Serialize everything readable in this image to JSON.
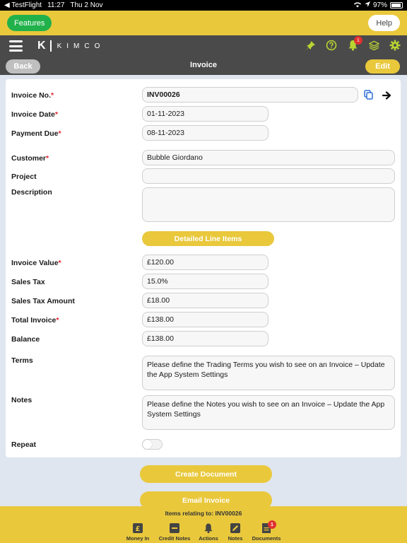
{
  "status_bar": {
    "carrier": "◀ TestFlight",
    "time": "11:27",
    "date": "Thu 2 Nov",
    "battery": "97%"
  },
  "top_bar": {
    "features_label": "Features",
    "help_label": "Help"
  },
  "nav": {
    "logo_letter": "K",
    "logo_word": "KIMCO",
    "notification_count": "1"
  },
  "sub_bar": {
    "back_label": "Back",
    "title": "Invoice",
    "edit_label": "Edit"
  },
  "form": {
    "invoice_no": {
      "label": "Invoice No.",
      "value": "INV00026"
    },
    "invoice_date": {
      "label": "Invoice Date",
      "value": "01-11-2023"
    },
    "payment_due": {
      "label": "Payment Due",
      "value": "08-11-2023"
    },
    "customer": {
      "label": "Customer",
      "value": "Bubble Giordano"
    },
    "project": {
      "label": "Project",
      "value": ""
    },
    "description": {
      "label": "Description",
      "value": ""
    },
    "line_items_label": "Detailed Line Items",
    "invoice_value": {
      "label": "Invoice Value",
      "value": "£120.00"
    },
    "sales_tax": {
      "label": "Sales Tax",
      "value": "15.0%"
    },
    "sales_tax_amount": {
      "label": "Sales Tax Amount",
      "value": "£18.00"
    },
    "total_invoice": {
      "label": "Total Invoice",
      "value": "£138.00"
    },
    "balance": {
      "label": "Balance",
      "value": "£138.00"
    },
    "terms": {
      "label": "Terms",
      "value": "Please define the Trading Terms you wish to see on an Invoice – Update the App System Settings"
    },
    "notes": {
      "label": "Notes",
      "value": "Please define the Notes you wish to see on an Invoice – Update the App System Settings"
    },
    "repeat": {
      "label": "Repeat",
      "on": false
    },
    "required_mark": "*"
  },
  "actions": {
    "create_document": "Create Document",
    "email_invoice": "Email Invoice"
  },
  "footer": {
    "relating_text": "Items relating to: INV00026"
  },
  "tabs": [
    {
      "label": "Money In",
      "icon": "pound-icon"
    },
    {
      "label": "Credit Notes",
      "icon": "credit-note-icon"
    },
    {
      "label": "Actions",
      "icon": "bell-icon"
    },
    {
      "label": "Notes",
      "icon": "pencil-icon"
    },
    {
      "label": "Documents",
      "icon": "document-icon",
      "badge": "1"
    }
  ],
  "colors": {
    "accent": "#e9c83c",
    "nav": "#4a4a4a",
    "green": "#21b14b",
    "required": "#e0242f"
  }
}
